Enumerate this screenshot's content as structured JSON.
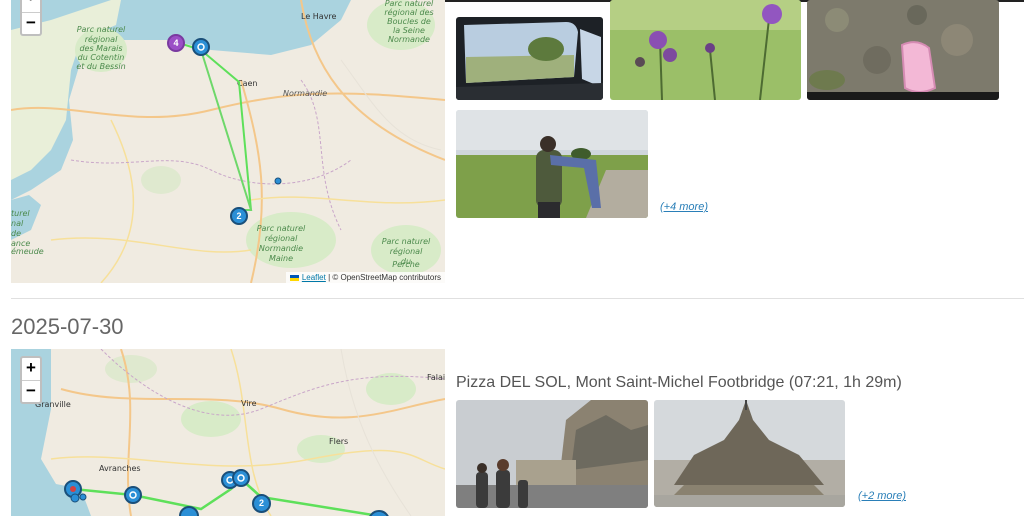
{
  "day1": {
    "map": {
      "zoom_out_label": "−",
      "attribution_link": "Leaflet",
      "attribution_text": " | © OpenStreetMap contributors",
      "places": [
        "Le Havre",
        "Caen",
        "Normandie",
        "Parc naturel régional des Marais du Cotentin et du Bessin",
        "Parc naturel régional des Boucles de la Seine Normande",
        "Parc naturel régional Normandie-Maine",
        "Parc naturel régional du Perche"
      ],
      "clusters": [
        {
          "count": "4"
        },
        {
          "count": "2"
        }
      ]
    },
    "more_link": "(+4 more)"
  },
  "day2": {
    "date": "2025-07-30",
    "map": {
      "zoom_in_label": "+",
      "zoom_out_label": "−",
      "places": [
        "Granville",
        "Vire",
        "Flers",
        "Avranches",
        "Falai"
      ],
      "clusters": [
        {
          "count": "2"
        }
      ]
    },
    "segment_title": "Pizza DEL SOL, Mont Saint-Michel Footbridge (07:21, 1h 29m)",
    "more_link": "(+2 more)"
  },
  "colors": {
    "track": "#5ee05a",
    "marker_blue": "#2b8fd6",
    "cluster_purple": "#9b4fc6",
    "sea": "#aad3df",
    "link": "#2a7fb8"
  }
}
